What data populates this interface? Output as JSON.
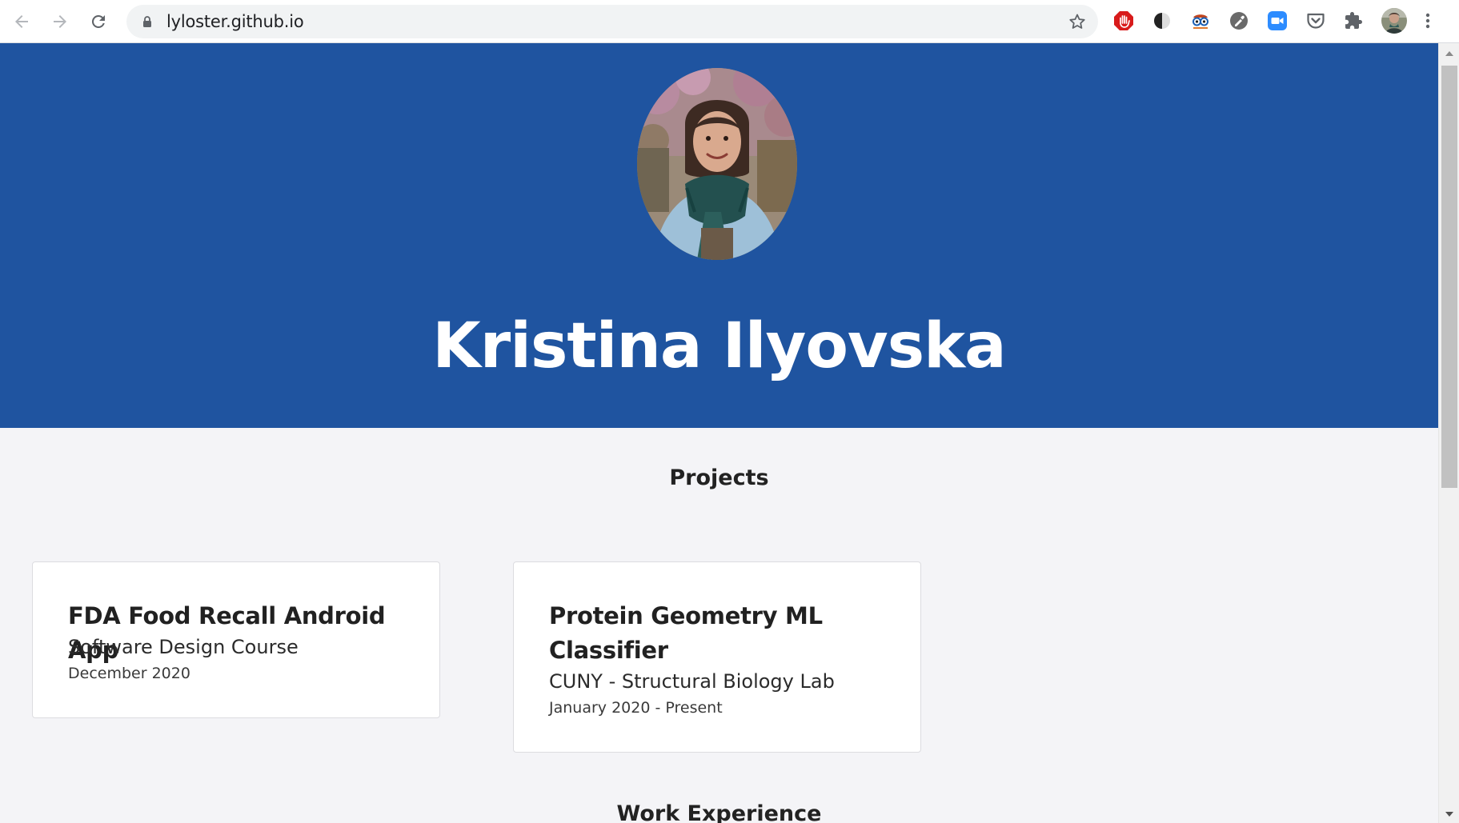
{
  "browser": {
    "url": "lyloster.github.io",
    "back_icon": "back-arrow-icon",
    "forward_icon": "forward-arrow-icon",
    "reload_icon": "reload-icon",
    "extensions": [
      "stop-hand-icon",
      "dark-mode-icon",
      "glasses-icon",
      "eyedropper-icon",
      "zoom-video-icon",
      "pocket-icon",
      "puzzle-extensions-icon"
    ],
    "accent": "#1a73e8"
  },
  "hero": {
    "name": "Kristina Ilyovska",
    "background": "#1f54a0"
  },
  "projects": {
    "heading": "Projects",
    "items": [
      {
        "title": "FDA Food Recall Android App",
        "subtitle": "Software Design Course",
        "date": "December 2020"
      },
      {
        "title": "Protein Geometry ML Classifier",
        "subtitle": "CUNY - Structural Biology Lab",
        "date": "January 2020 - Present"
      }
    ]
  },
  "work": {
    "heading": "Work Experience"
  }
}
